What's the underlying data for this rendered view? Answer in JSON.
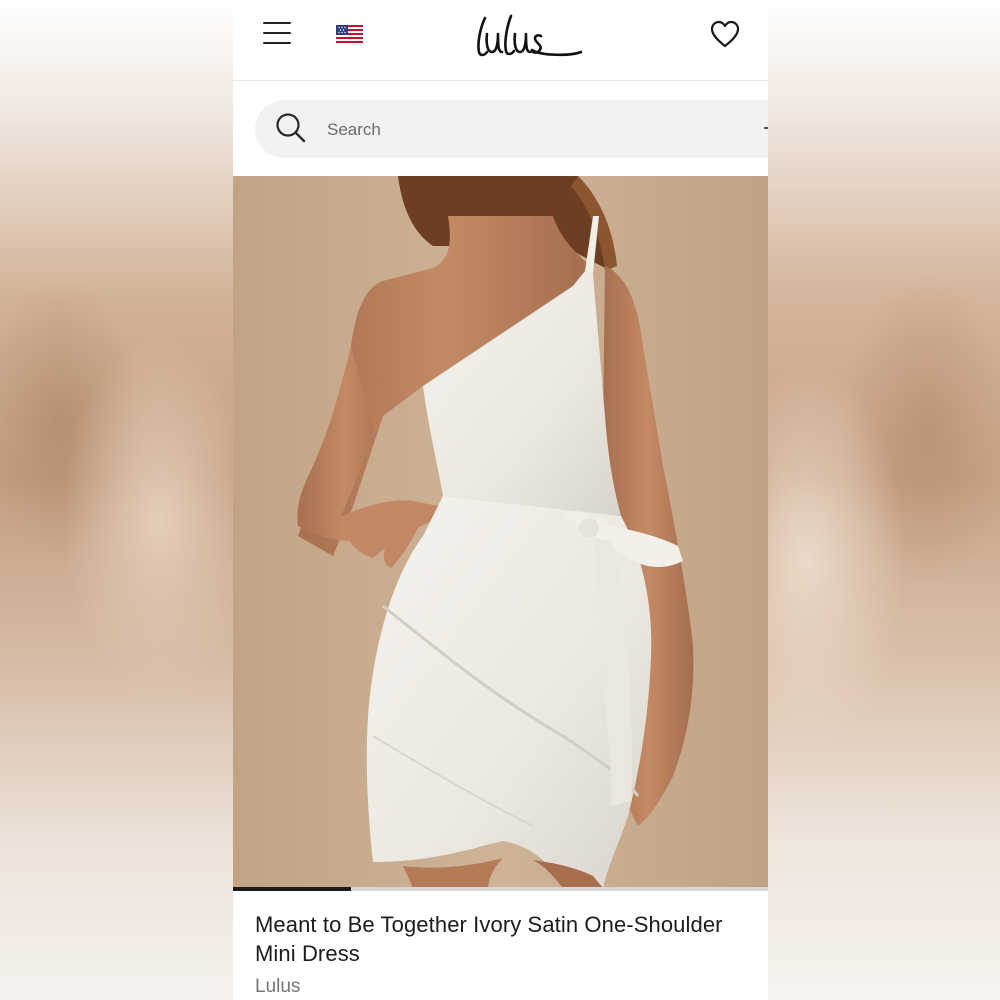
{
  "header": {
    "logo_text": "Lulus",
    "menu_icon": "hamburger-menu-icon",
    "flag_icon": "us-flag-icon",
    "wishlist_icon": "heart-icon"
  },
  "search": {
    "placeholder": "Search",
    "icon": "search-icon"
  },
  "product": {
    "image": "model wearing white one-shoulder wrap mini dress",
    "title": "Meant to Be Together Ivory Satin One-Shoulder Mini Dress",
    "brand": "Lulus",
    "gallery_progress": 0.22
  },
  "colors": {
    "background_tan": "#c5a88b",
    "text_primary": "#1c1c1c",
    "text_secondary": "#767676",
    "search_bg": "#f2f2f2"
  }
}
